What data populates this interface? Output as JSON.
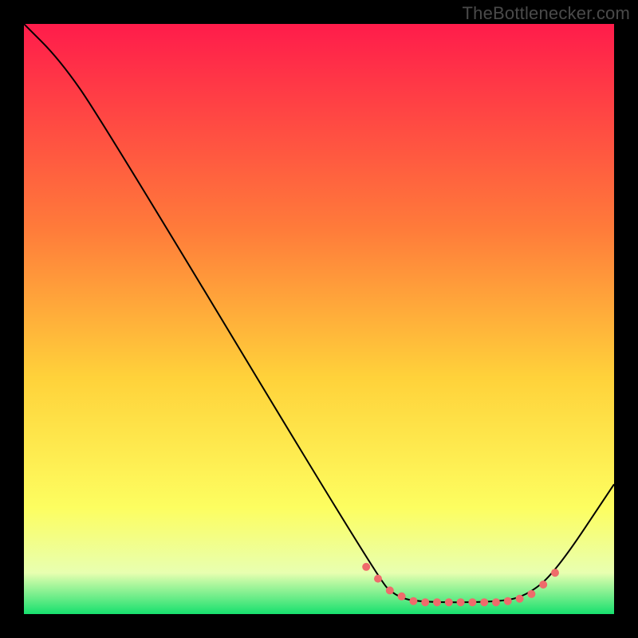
{
  "attribution": "TheBottlenecker.com",
  "chart_data": {
    "type": "line",
    "title": "",
    "xlabel": "",
    "ylabel": "",
    "xlim": [
      0,
      100
    ],
    "ylim": [
      0,
      100
    ],
    "background_gradient": {
      "stops": [
        {
          "offset": 0,
          "color": "#ff1c4b"
        },
        {
          "offset": 35,
          "color": "#ff7c3a"
        },
        {
          "offset": 60,
          "color": "#ffd23a"
        },
        {
          "offset": 82,
          "color": "#fdfe60"
        },
        {
          "offset": 93,
          "color": "#e8ffb0"
        },
        {
          "offset": 100,
          "color": "#17e06e"
        }
      ]
    },
    "series": [
      {
        "name": "curve",
        "color": "#000000",
        "stroke_width": 2,
        "points": [
          {
            "x": 0,
            "y": 100
          },
          {
            "x": 6,
            "y": 94
          },
          {
            "x": 13,
            "y": 84
          },
          {
            "x": 60,
            "y": 6
          },
          {
            "x": 63,
            "y": 3
          },
          {
            "x": 67,
            "y": 2
          },
          {
            "x": 80,
            "y": 2
          },
          {
            "x": 85,
            "y": 3
          },
          {
            "x": 90,
            "y": 7
          },
          {
            "x": 100,
            "y": 22
          }
        ]
      }
    ],
    "markers": {
      "color": "#ef6b6b",
      "radius": 5,
      "points": [
        {
          "x": 58,
          "y": 8
        },
        {
          "x": 60,
          "y": 6
        },
        {
          "x": 62,
          "y": 4
        },
        {
          "x": 64,
          "y": 3
        },
        {
          "x": 66,
          "y": 2.2
        },
        {
          "x": 68,
          "y": 2
        },
        {
          "x": 70,
          "y": 2
        },
        {
          "x": 72,
          "y": 2
        },
        {
          "x": 74,
          "y": 2
        },
        {
          "x": 76,
          "y": 2
        },
        {
          "x": 78,
          "y": 2
        },
        {
          "x": 80,
          "y": 2
        },
        {
          "x": 82,
          "y": 2.2
        },
        {
          "x": 84,
          "y": 2.6
        },
        {
          "x": 86,
          "y": 3.4
        },
        {
          "x": 88,
          "y": 5
        },
        {
          "x": 90,
          "y": 7
        }
      ]
    }
  }
}
